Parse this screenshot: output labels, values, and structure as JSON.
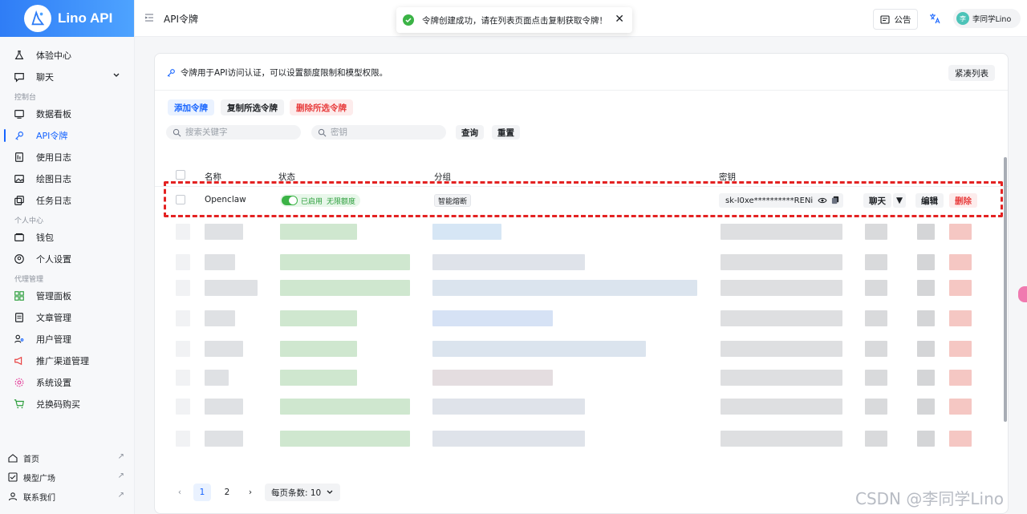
{
  "brand": {
    "name": "Lino API"
  },
  "sidebar": {
    "items": [
      {
        "label": "体验中心",
        "icon": "flask-icon"
      },
      {
        "label": "聊天",
        "icon": "chat-icon"
      },
      {
        "label": "数据看板",
        "icon": "dashboard-icon"
      },
      {
        "label": "API令牌",
        "icon": "key-icon"
      },
      {
        "label": "使用日志",
        "icon": "log-icon"
      },
      {
        "label": "绘图日志",
        "icon": "image-icon"
      },
      {
        "label": "任务日志",
        "icon": "task-icon"
      },
      {
        "label": "钱包",
        "icon": "wallet-icon"
      },
      {
        "label": "个人设置",
        "icon": "user-settings-icon"
      },
      {
        "label": "管理面板",
        "icon": "grid-icon"
      },
      {
        "label": "文章管理",
        "icon": "article-icon"
      },
      {
        "label": "用户管理",
        "icon": "users-icon"
      },
      {
        "label": "推广渠道管理",
        "icon": "megaphone-icon"
      },
      {
        "label": "系统设置",
        "icon": "gear-icon"
      },
      {
        "label": "兑换码购买",
        "icon": "cart-icon"
      }
    ],
    "sections": {
      "console": "控制台",
      "personal": "个人中心",
      "agent": "代理管理"
    },
    "bottom": [
      {
        "label": "首页"
      },
      {
        "label": "模型广场"
      },
      {
        "label": "联系我们"
      }
    ],
    "active_color": "#1664ff"
  },
  "header": {
    "title": "API令牌",
    "notice_label": "公告",
    "user_name": "李同学Lino",
    "avatar_text": "李"
  },
  "toast": {
    "message": "令牌创建成功，请在列表页面点击复制获取令牌！"
  },
  "card": {
    "description": "令牌用于API访问认证，可以设置额度限制和模型权限。",
    "compact_label": "紧凑列表",
    "buttons": {
      "add": "添加令牌",
      "copy": "复制所选令牌",
      "delete": "删除所选令牌"
    },
    "search": {
      "keyword_placeholder": "搜索关键字",
      "key_placeholder": "密钥"
    },
    "query_label": "查询",
    "reset_label": "重置"
  },
  "table": {
    "columns": {
      "name": "名称",
      "status": "状态",
      "group": "分组",
      "key": "密钥"
    },
    "row": {
      "name": "Openclaw",
      "status": "已启用",
      "quota": "无限额度",
      "group": "智能熔断",
      "key": "sk-I0xe**********RENi",
      "actions": {
        "chat": "聊天",
        "edit": "编辑",
        "delete": "删除"
      }
    }
  },
  "pager": {
    "pages": [
      "1",
      "2"
    ],
    "per_page_label": "每页条数: 10"
  },
  "watermark": "CSDN @李同学Lino"
}
